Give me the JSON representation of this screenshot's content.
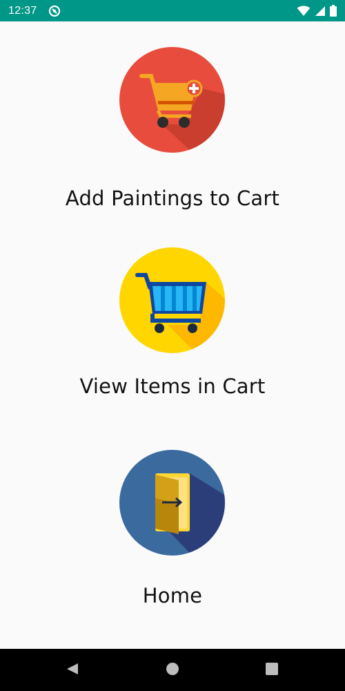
{
  "status_bar": {
    "time": "12:37",
    "notification_icon": "sync-disabled-icon",
    "wifi_icon": "wifi-icon",
    "cell_icon": "cell-signal-icon",
    "battery_icon": "battery-icon",
    "color": "#009688"
  },
  "menu": {
    "items": [
      {
        "label": "Add Paintings to Cart",
        "icon": "add-to-cart-icon",
        "icon_color": "#e74c3c"
      },
      {
        "label": "View Items in Cart",
        "icon": "view-cart-icon",
        "icon_color": "#ffd600"
      },
      {
        "label": "Home",
        "icon": "exit-door-icon",
        "icon_color": "#3a6a9e"
      }
    ]
  },
  "nav_bar": {
    "back_icon": "back-triangle-icon",
    "home_icon": "home-circle-icon",
    "recents_icon": "recents-square-icon"
  }
}
